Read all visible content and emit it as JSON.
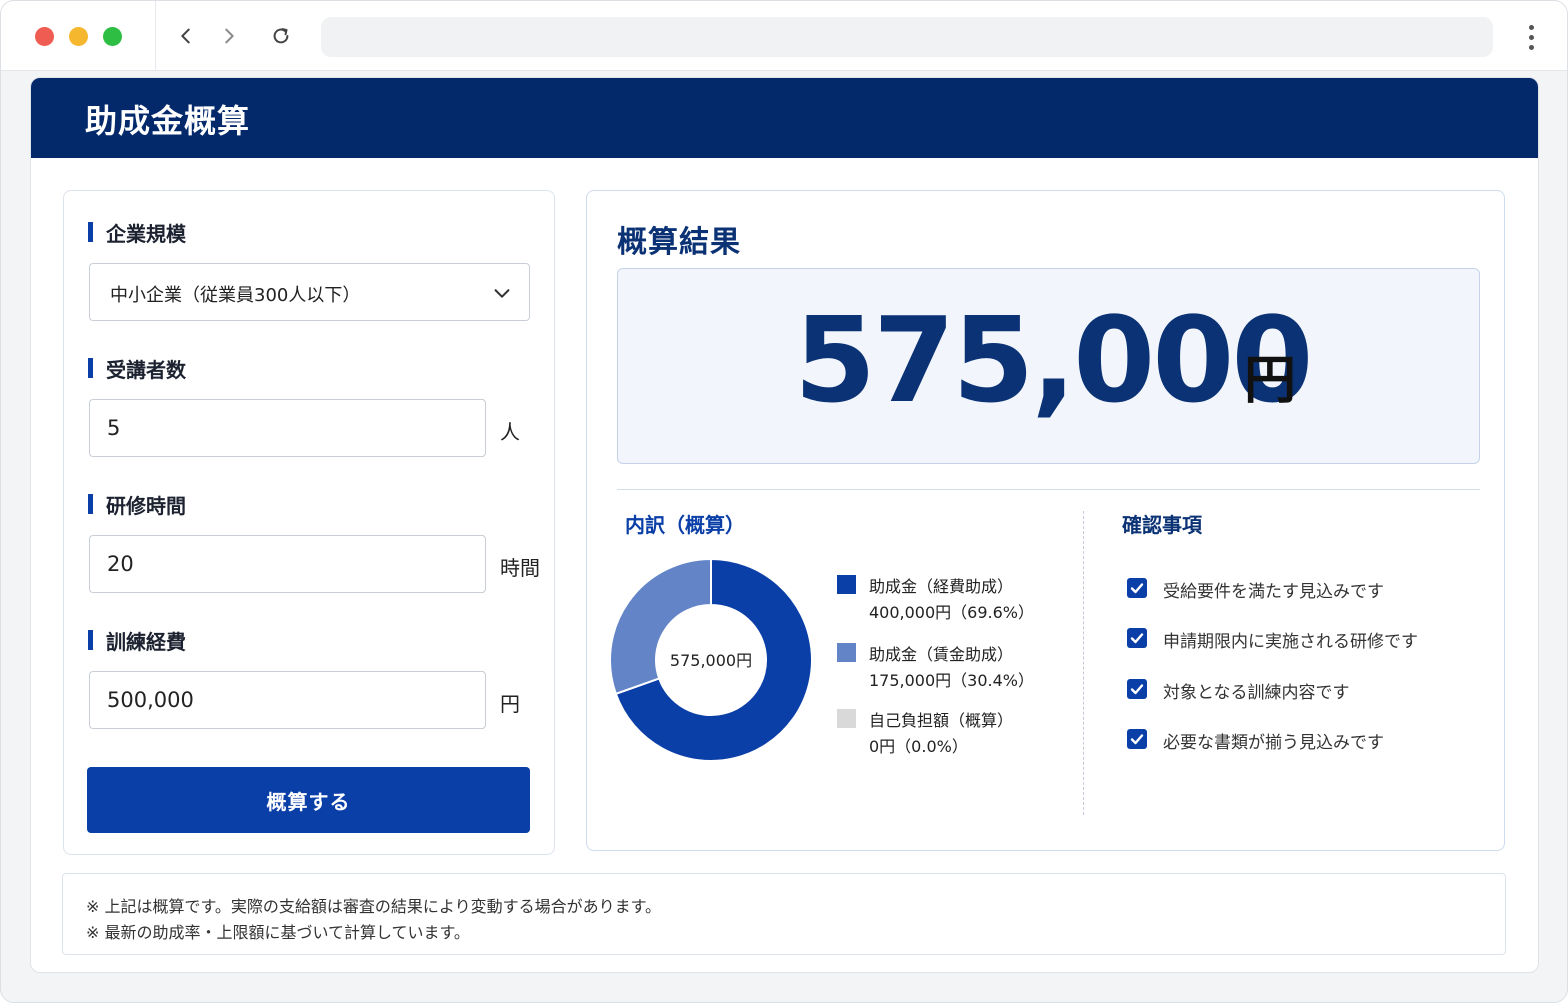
{
  "page": {
    "title": "助成金概算"
  },
  "form": {
    "company_size": {
      "label": "企業規模",
      "selected": "中小企業（従業員300人以下）"
    },
    "participants": {
      "label": "受講者数",
      "value": "5",
      "unit": "人"
    },
    "training_hours": {
      "label": "研修時間",
      "value": "20",
      "unit": "時間"
    },
    "training_cost": {
      "label": "訓練経費",
      "value": "500,000",
      "unit": "円"
    },
    "submit_label": "概算する"
  },
  "result": {
    "title": "概算結果",
    "total_amount": "575,000",
    "total_unit": "円",
    "breakdown_title": "内訳（概算）",
    "donut_center": "575,000円",
    "checklist_title": "確認事項",
    "checklist": [
      {
        "label": "受給要件を満たす見込みです",
        "checked": true
      },
      {
        "label": "申請期限内に実施される研修です",
        "checked": true
      },
      {
        "label": "対象となる訓練内容です",
        "checked": true
      },
      {
        "label": "必要な書類が揃う見込みです",
        "checked": true
      }
    ]
  },
  "chart_data": {
    "type": "pie",
    "categories": [
      "助成金（経費助成）",
      "助成金（賃金助成）",
      "自己負担額（概算）"
    ],
    "values": [
      400000,
      175000,
      0
    ],
    "percentages": [
      69.6,
      30.4,
      0.0
    ],
    "amount_labels": [
      "400,000円（69.6%）",
      "175,000円（30.4%）",
      "0円（0.0%）"
    ],
    "colors": [
      "#0b3fa8",
      "#6385c8",
      "#d9d9d9"
    ],
    "center_label": "575,000円"
  },
  "notes": [
    "※ 上記は概算です。実際の支給額は審査の結果により変動する場合があります。",
    "※ 最新の助成率・上限額に基づいて計算しています。"
  ],
  "icons": {
    "back": "chevron-left-icon",
    "forward": "chevron-right-icon",
    "reload": "reload-icon",
    "menu": "kebab-menu-icon",
    "select": "chevron-down-icon",
    "check": "checkmark-icon"
  }
}
